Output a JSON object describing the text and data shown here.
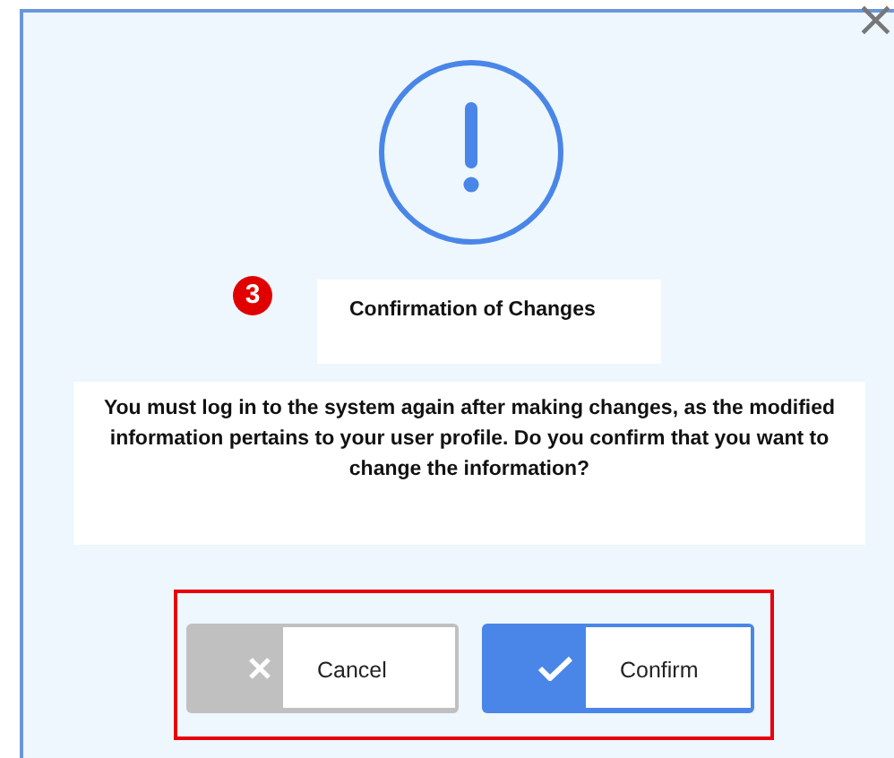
{
  "close_button": {
    "label": "×"
  },
  "dialog": {
    "step_badge": "3",
    "title": "Confirmation of Changes",
    "message": "You must log in to the system again after making changes, as the modified information pertains to your user profile. Do you confirm that you want to change the information?"
  },
  "buttons_highlighted": true,
  "buttons": [
    {
      "kind": "cancel",
      "label": "Cancel"
    },
    {
      "kind": "confirm",
      "label": "Confirm"
    }
  ]
}
